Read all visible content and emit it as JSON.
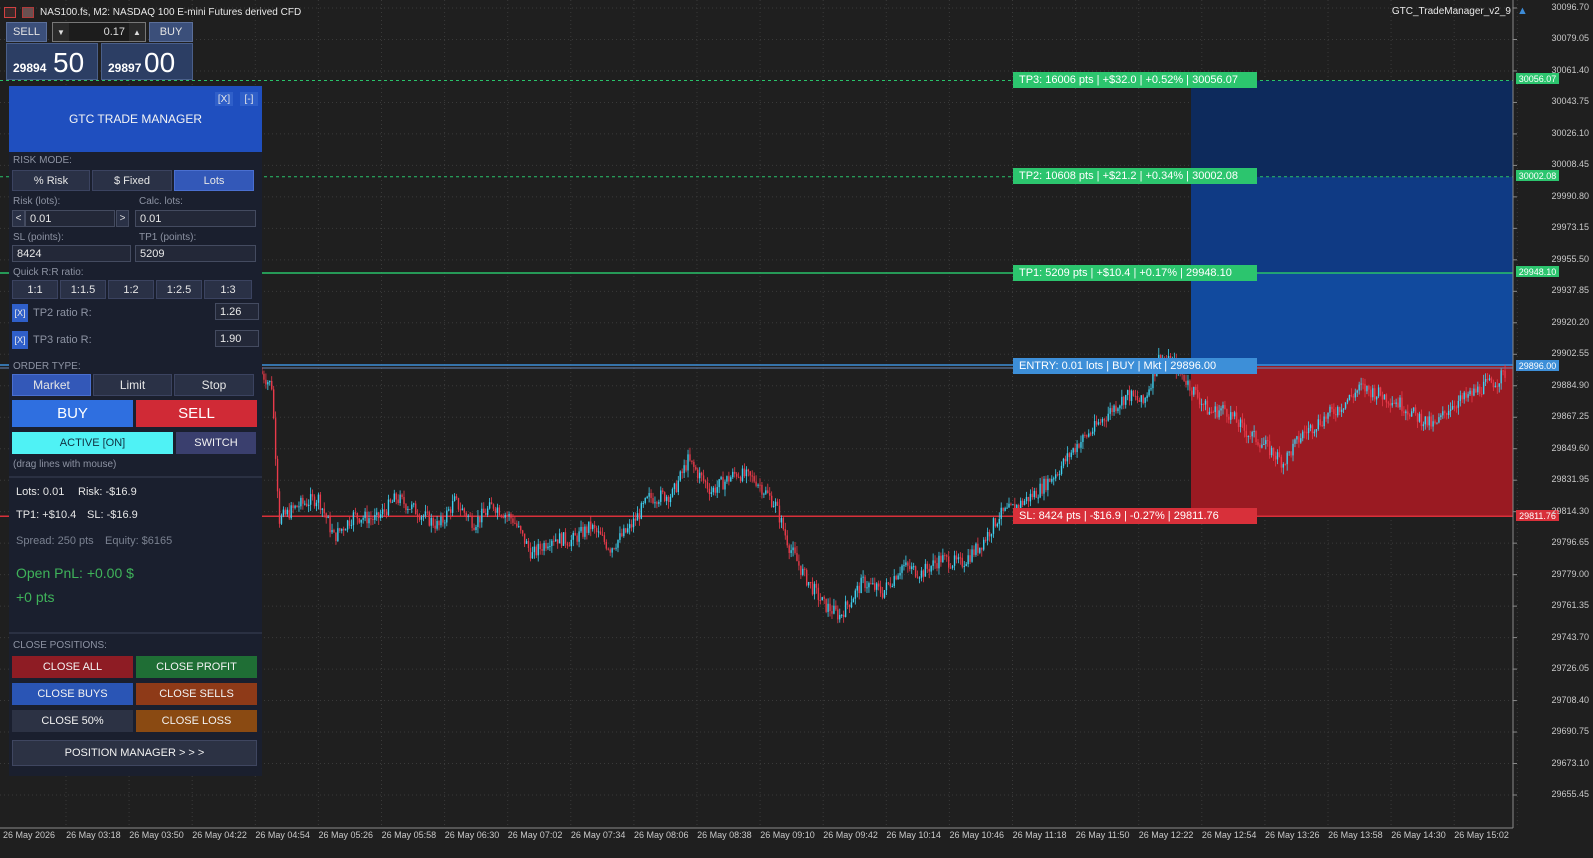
{
  "window": {
    "symbol_title": "NAS100.fs, M2:  NASDAQ 100 E-mini Futures derived CFD",
    "ea_name": "GTC_TradeManager_v2_9"
  },
  "one_click": {
    "sell_label": "SELL",
    "buy_label": "BUY",
    "lot_value": "0.17",
    "sell_price_small": "29894",
    "sell_price_big": "50",
    "buy_price_small": "29897",
    "buy_price_big": "00"
  },
  "panel": {
    "title": "GTC TRADE MANAGER",
    "close_btn": "[X]",
    "min_btn": "[-]",
    "risk_mode_label": "RISK MODE:",
    "risk_modes": [
      "% Risk",
      "$ Fixed",
      "Lots"
    ],
    "risk_lots_label": "Risk (lots):",
    "risk_lots_value": "0.01",
    "calc_lots_label": "Calc. lots:",
    "calc_lots_value": "0.01",
    "sl_label": "SL (points):",
    "sl_value": "8424",
    "tp1_label": "TP1 (points):",
    "tp1_value": "5209",
    "rr_label": "Quick R:R ratio:",
    "rr_buttons": [
      "1:1",
      "1:1.5",
      "1:2",
      "1:2.5",
      "1:3"
    ],
    "tp2_check": "[X]",
    "tp2_label": "TP2 ratio R:",
    "tp2_value": "1.26",
    "tp3_check": "[X]",
    "tp3_label": "TP3 ratio R:",
    "tp3_value": "1.90",
    "order_type_label": "ORDER TYPE:",
    "order_types": [
      "Market",
      "Limit",
      "Stop"
    ],
    "buy_label": "BUY",
    "sell_label": "SELL",
    "active_label": "ACTIVE [ON]",
    "switch_label": "SWITCH",
    "drag_hint": "(drag lines with mouse)",
    "lots_info": "Lots: 0.01",
    "risk_info": "Risk: -$16.9",
    "tp1_info": "TP1: +$10.4",
    "sl_info": "SL: -$16.9",
    "spread_info": "Spread: 250 pts",
    "equity_info": "Equity: $6165",
    "open_pnl": "Open PnL: +0.00 $",
    "open_pts": "+0 pts",
    "close_positions_label": "CLOSE POSITIONS:",
    "close_all": "CLOSE ALL",
    "close_profit": "CLOSE PROFIT",
    "close_buys": "CLOSE BUYS",
    "close_sells": "CLOSE SELLS",
    "close_50": "CLOSE 50%",
    "close_loss": "CLOSE LOSS",
    "position_manager": "POSITION MANAGER  > > >"
  },
  "levels": {
    "tp3": "TP3: 16006 pts | +$32.0 | +0.52% | 30056.07",
    "tp2": "TP2: 10608 pts | +$21.2 | +0.34% | 30002.08",
    "tp1": "TP1: 5209 pts | +$10.4 | +0.17% | 29948.10",
    "entry": "ENTRY: 0.01 lots | BUY | Mkt | 29896.00",
    "sl": "SL: 8424 pts | -$16.9 | -0.27% | 29811.76"
  },
  "level_prices": {
    "tp3": "30056.07",
    "tp2": "30002.08",
    "tp1": "29948.10",
    "entry": "29896.00",
    "sl": "29811.76"
  },
  "colors": {
    "tp": "#29c26a",
    "entry": "#3d8fd8",
    "sl": "#d8303a",
    "tp_zone": "#0f3f8f",
    "sl_zone": "#9a1a22",
    "bull": "#3fd0f0",
    "bear": "#e83a4a"
  },
  "price_axis": [
    "30096.70",
    "30079.05",
    "30061.40",
    "30043.75",
    "30026.10",
    "30008.45",
    "29990.80",
    "29973.15",
    "29955.50",
    "29937.85",
    "29920.20",
    "29902.55",
    "29884.90",
    "29867.25",
    "29849.60",
    "29831.95",
    "29814.30",
    "29796.65",
    "29779.00",
    "29761.35",
    "29743.70",
    "29726.05",
    "29708.40",
    "29690.75",
    "29673.10",
    "29655.45"
  ],
  "time_axis": [
    "26 May 2026",
    "26 May 03:18",
    "26 May 03:50",
    "26 May 04:22",
    "26 May 04:54",
    "26 May 05:26",
    "26 May 05:58",
    "26 May 06:30",
    "26 May 07:02",
    "26 May 07:34",
    "26 May 08:06",
    "26 May 08:38",
    "26 May 09:10",
    "26 May 09:42",
    "26 May 10:14",
    "26 May 10:46",
    "26 May 11:18",
    "26 May 11:50",
    "26 May 12:22",
    "26 May 12:54",
    "26 May 13:26",
    "26 May 13:58",
    "26 May 14:30",
    "26 May 15:02"
  ],
  "chart_data": {
    "type": "candlestick",
    "y_range": [
      29641,
      30101
    ],
    "path": [
      [
        0,
        29893
      ],
      [
        6,
        29885
      ],
      [
        10,
        29810
      ],
      [
        20,
        29818
      ],
      [
        30,
        29822
      ],
      [
        38,
        29800
      ],
      [
        48,
        29812
      ],
      [
        60,
        29810
      ],
      [
        70,
        29822
      ],
      [
        80,
        29815
      ],
      [
        92,
        29806
      ],
      [
        100,
        29820
      ],
      [
        110,
        29808
      ],
      [
        120,
        29818
      ],
      [
        130,
        29810
      ],
      [
        140,
        29790
      ],
      [
        150,
        29800
      ],
      [
        160,
        29798
      ],
      [
        170,
        29806
      ],
      [
        180,
        29794
      ],
      [
        190,
        29805
      ],
      [
        200,
        29822
      ],
      [
        212,
        29824
      ],
      [
        220,
        29843
      ],
      [
        232,
        29826
      ],
      [
        245,
        29836
      ],
      [
        255,
        29832
      ],
      [
        265,
        29818
      ],
      [
        272,
        29795
      ],
      [
        280,
        29778
      ],
      [
        290,
        29762
      ],
      [
        298,
        29756
      ],
      [
        310,
        29775
      ],
      [
        320,
        29769
      ],
      [
        330,
        29784
      ],
      [
        340,
        29780
      ],
      [
        350,
        29788
      ],
      [
        360,
        29785
      ],
      [
        370,
        29795
      ],
      [
        380,
        29812
      ],
      [
        390,
        29818
      ],
      [
        400,
        29826
      ],
      [
        410,
        29837
      ],
      [
        420,
        29852
      ],
      [
        428,
        29860
      ],
      [
        438,
        29872
      ],
      [
        446,
        29880
      ],
      [
        454,
        29875
      ],
      [
        462,
        29900
      ],
      [
        470,
        29897
      ],
      [
        478,
        29885
      ],
      [
        488,
        29870
      ],
      [
        496,
        29872
      ],
      [
        506,
        29860
      ],
      [
        516,
        29852
      ],
      [
        526,
        29842
      ],
      [
        536,
        29858
      ],
      [
        546,
        29866
      ],
      [
        556,
        29874
      ],
      [
        566,
        29884
      ],
      [
        576,
        29880
      ],
      [
        586,
        29875
      ],
      [
        594,
        29868
      ],
      [
        604,
        29862
      ],
      [
        612,
        29874
      ],
      [
        620,
        29878
      ],
      [
        628,
        29884
      ],
      [
        636,
        29888
      ],
      [
        640,
        29892
      ]
    ]
  }
}
